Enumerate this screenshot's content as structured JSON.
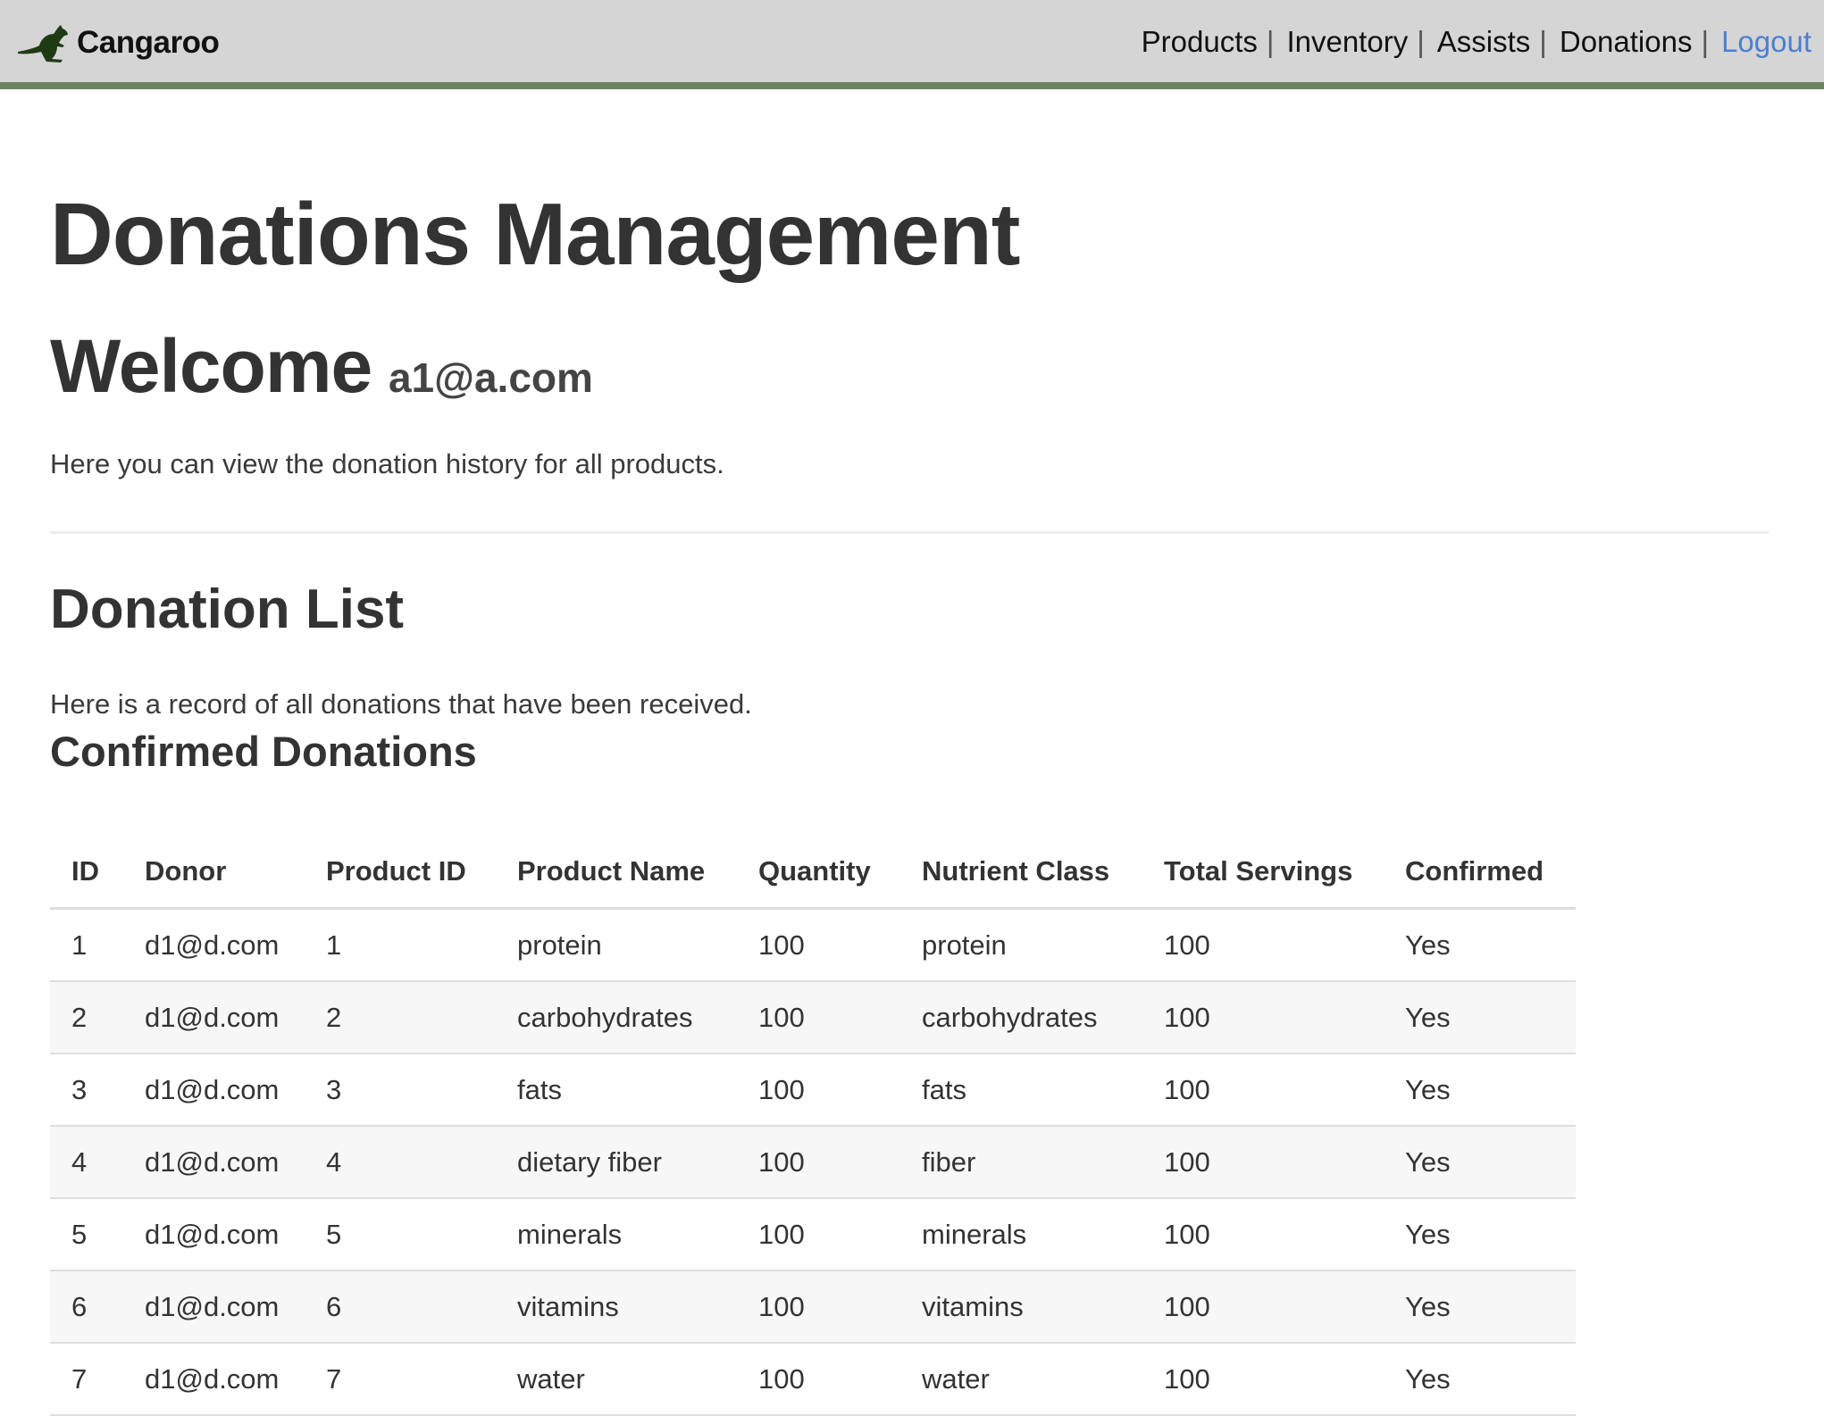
{
  "navbar": {
    "brand": "Cangaroo",
    "logo_icon": "kangaroo-icon",
    "links": [
      {
        "label": "Products"
      },
      {
        "label": "Inventory"
      },
      {
        "label": "Assists"
      },
      {
        "label": "Donations"
      }
    ],
    "separator": "|",
    "logout": "Logout",
    "accent_color": "#6b8461",
    "link_color": "#4a7fd4"
  },
  "page": {
    "title": "Donations Management",
    "welcome": "Welcome",
    "user_email": "a1@a.com",
    "intro": "Here you can view the donation history for all products."
  },
  "donation_list": {
    "title": "Donation List",
    "description": "Here is a record of all donations that have been received.",
    "confirmed": {
      "title": "Confirmed Donations",
      "columns": [
        "ID",
        "Donor",
        "Product ID",
        "Product Name",
        "Quantity",
        "Nutrient Class",
        "Total Servings",
        "Confirmed"
      ],
      "rows": [
        [
          "1",
          "d1@d.com",
          "1",
          "protein",
          "100",
          "protein",
          "100",
          "Yes"
        ],
        [
          "2",
          "d1@d.com",
          "2",
          "carbohydrates",
          "100",
          "carbohydrates",
          "100",
          "Yes"
        ],
        [
          "3",
          "d1@d.com",
          "3",
          "fats",
          "100",
          "fats",
          "100",
          "Yes"
        ],
        [
          "4",
          "d1@d.com",
          "4",
          "dietary fiber",
          "100",
          "fiber",
          "100",
          "Yes"
        ],
        [
          "5",
          "d1@d.com",
          "5",
          "minerals",
          "100",
          "minerals",
          "100",
          "Yes"
        ],
        [
          "6",
          "d1@d.com",
          "6",
          "vitamins",
          "100",
          "vitamins",
          "100",
          "Yes"
        ],
        [
          "7",
          "d1@d.com",
          "7",
          "water",
          "100",
          "water",
          "100",
          "Yes"
        ]
      ]
    }
  }
}
